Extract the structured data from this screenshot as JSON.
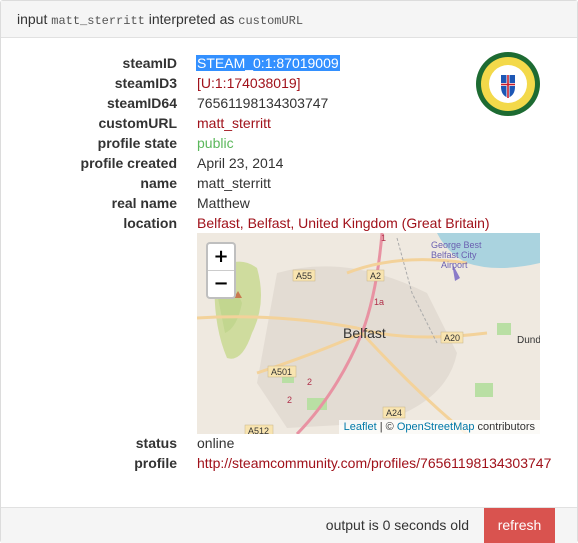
{
  "heading": {
    "prefix": "input",
    "input_value": "matt_sterritt",
    "middle": "interpreted as",
    "interpreted_as": "customURL"
  },
  "profile": {
    "fields": [
      {
        "label": "steamID",
        "value": "STEAM_0:1:87019009"
      },
      {
        "label": "steamID3",
        "value": "[U:1:174038019]"
      },
      {
        "label": "steamID64",
        "value": "76561198134303747"
      },
      {
        "label": "customURL",
        "value": "matt_sterritt"
      },
      {
        "label": "profile state",
        "value": "public"
      },
      {
        "label": "profile created",
        "value": "April 23, 2014"
      },
      {
        "label": "name",
        "value": "matt_sterritt"
      },
      {
        "label": "real name",
        "value": "Matthew"
      },
      {
        "label": "location",
        "value": "Belfast, Belfast, United Kingdom (Great Britain)"
      }
    ],
    "status_label": "status",
    "status_value": "online",
    "profile_label": "profile",
    "profile_url": "http://steamcommunity.com/profiles/76561198134303747"
  },
  "map": {
    "zoom_in": "+",
    "zoom_out": "−",
    "city_label": "Belfast",
    "airport_label_1": "George Best",
    "airport_label_2": "Belfast City",
    "airport_label_3": "Airport",
    "dundonald_label": "Dund",
    "roads": [
      "A55",
      "A2",
      "A20",
      "A501",
      "A24",
      "A512",
      "1",
      "1a",
      "2",
      "2"
    ],
    "attribution_leaflet": "Leaflet",
    "attribution_sep": " | © ",
    "attribution_osm": "OpenStreetMap",
    "attribution_suffix": " contributors"
  },
  "footer": {
    "output_text": "output is 0 seconds old",
    "refresh_label": "refresh"
  },
  "colors": {
    "link": "#a0111a",
    "public": "#5cb85c",
    "refresh_bg": "#d9534f",
    "selection": "#3390ff"
  }
}
